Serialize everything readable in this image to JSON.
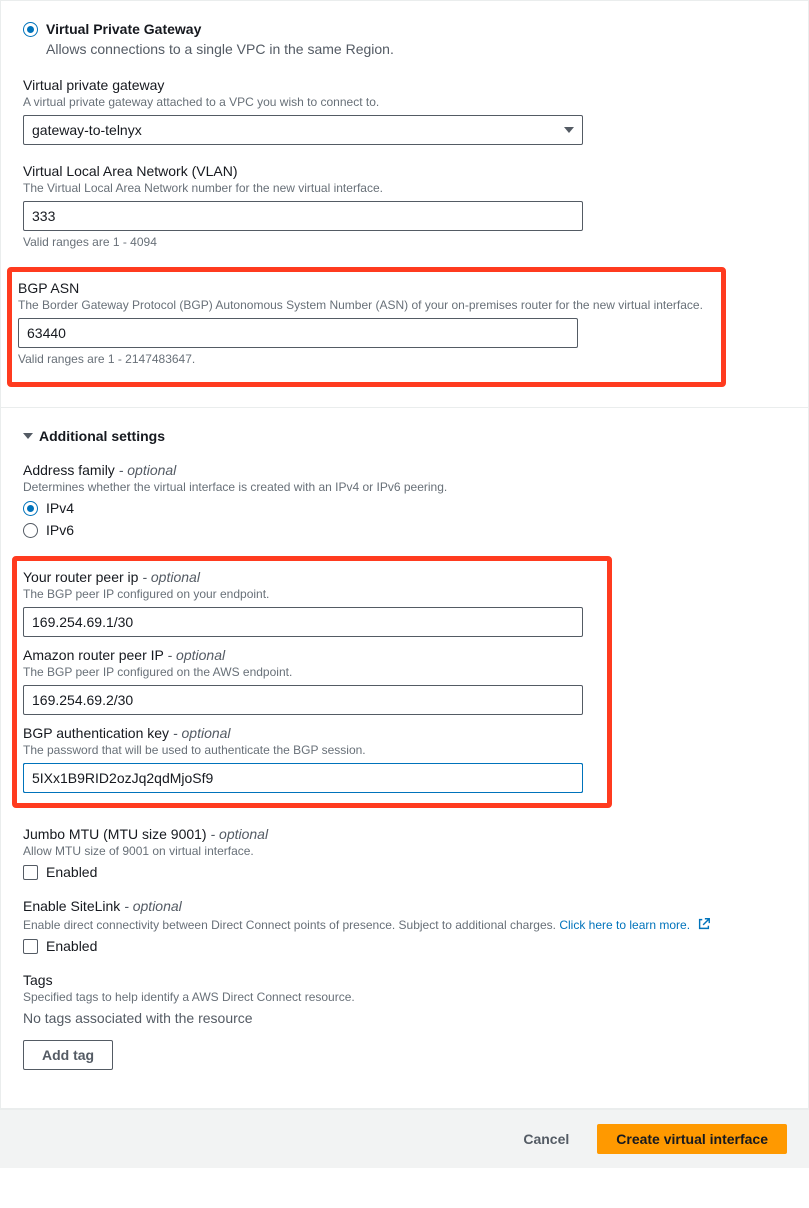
{
  "gateway_type": {
    "radio_label": "Virtual Private Gateway",
    "radio_desc": "Allows connections to a single VPC in the same Region."
  },
  "vpg_field": {
    "label": "Virtual private gateway",
    "help": "A virtual private gateway attached to a VPC you wish to connect to.",
    "value": "gateway-to-telnyx"
  },
  "vlan_field": {
    "label": "Virtual Local Area Network (VLAN)",
    "help": "The Virtual Local Area Network number for the new virtual interface.",
    "value": "333",
    "hint": "Valid ranges are 1 - 4094"
  },
  "bgp_asn_field": {
    "label": "BGP ASN",
    "help": "The Border Gateway Protocol (BGP) Autonomous System Number (ASN) of your on-premises router for the new virtual interface.",
    "value": "63440",
    "hint": "Valid ranges are 1 - 2147483647."
  },
  "additional_header": "Additional settings",
  "address_family": {
    "label": "Address family",
    "optional": "- optional",
    "help": "Determines whether the virtual interface is created with an IPv4 or IPv6 peering.",
    "ipv4": "IPv4",
    "ipv6": "IPv6"
  },
  "router_peer": {
    "label": "Your router peer ip",
    "optional": "- optional",
    "help": "The BGP peer IP configured on your endpoint.",
    "value": "169.254.69.1/30"
  },
  "amazon_peer": {
    "label": "Amazon router peer IP",
    "optional": "- optional",
    "help": "The BGP peer IP configured on the AWS endpoint.",
    "value": "169.254.69.2/30"
  },
  "bgp_auth": {
    "label": "BGP authentication key",
    "optional": "- optional",
    "help": "The password that will be used to authenticate the BGP session.",
    "value": "5IXx1B9RID2ozJq2qdMjoSf9"
  },
  "jumbo_mtu": {
    "label": "Jumbo MTU (MTU size 9001)",
    "optional": "- optional",
    "help": "Allow MTU size of 9001 on virtual interface.",
    "checkbox_label": "Enabled"
  },
  "sitelink": {
    "label": "Enable SiteLink",
    "optional": "- optional",
    "help": "Enable direct connectivity between Direct Connect points of presence. Subject to additional charges.",
    "link_text": "Click here to learn more.",
    "checkbox_label": "Enabled"
  },
  "tags": {
    "label": "Tags",
    "help": "Specified tags to help identify a AWS Direct Connect resource.",
    "empty": "No tags associated with the resource",
    "add_label": "Add tag"
  },
  "footer": {
    "cancel": "Cancel",
    "create": "Create virtual interface"
  }
}
